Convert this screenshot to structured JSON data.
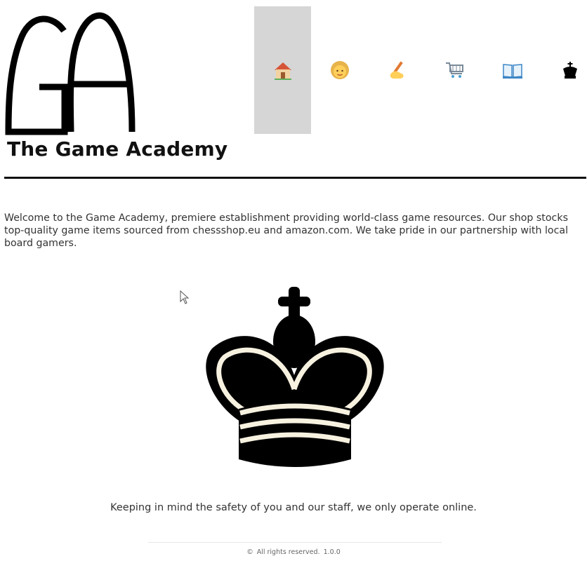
{
  "header": {
    "logo_icon": "ga-monogram-logo",
    "site_title": "The Game Academy"
  },
  "nav": {
    "items": [
      {
        "icon": "house-icon",
        "glyph": "🏠",
        "active": true
      },
      {
        "icon": "person-icon",
        "glyph": "👩",
        "active": false
      },
      {
        "icon": "writing-hand-icon",
        "glyph": "✍️",
        "active": false
      },
      {
        "icon": "shopping-cart-icon",
        "glyph": "🛒",
        "active": false
      },
      {
        "icon": "open-book-icon",
        "glyph": "📖",
        "active": false
      },
      {
        "icon": "chess-king-icon",
        "glyph": "♚",
        "active": false
      }
    ]
  },
  "main": {
    "intro": "Welcome to the Game Academy, premiere establishment providing world-class game resources. Our shop stocks top-quality game items sourced from chessshop.eu and amazon.com. We take pride in our partnership with local board gamers.",
    "hero_image": "chess-king-illustration",
    "safety_note": "Keeping in mind the safety of you and our staff, we only operate online."
  },
  "footer": {
    "copyright_symbol": "©",
    "text": "All rights reserved.",
    "version": "1.0.0"
  },
  "colors": {
    "nav_active_bg": "#d6d6d6",
    "rule": "#111111",
    "king_cream": "#f7f1e0"
  }
}
